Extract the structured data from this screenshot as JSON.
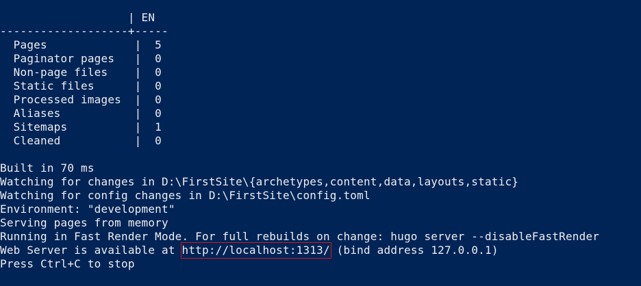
{
  "colors": {
    "background": "#012456",
    "text": "#eeedf0",
    "highlight_box": "#d11a1a"
  },
  "stats_table": {
    "header_line": "                   | EN",
    "separator_line": "-------------------+-----",
    "rows": [
      "  Pages             |  5",
      "  Paginator pages   |  0",
      "  Non-page files    |  0",
      "  Static files      |  0",
      "  Processed images  |  0",
      "  Aliases           |  0",
      "  Sitemaps          |  1",
      "  Cleaned           |  0"
    ]
  },
  "log": {
    "built": "Built in 70 ms",
    "watching_content": "Watching for changes in D:\\FirstSite\\{archetypes,content,data,layouts,static}",
    "watching_config": "Watching for config changes in D:\\FirstSite\\config.toml",
    "environment": "Environment: \"development\"",
    "serving": "Serving pages from memory",
    "fast_render": "Running in Fast Render Mode. For full rebuilds on change: hugo server --disableFastRender",
    "web_server_prefix": "Web Server is available at ",
    "web_server_url": "http://localhost:1313/",
    "web_server_suffix": " (bind address 127.0.0.1)",
    "stop_hint": "Press Ctrl+C to stop"
  }
}
